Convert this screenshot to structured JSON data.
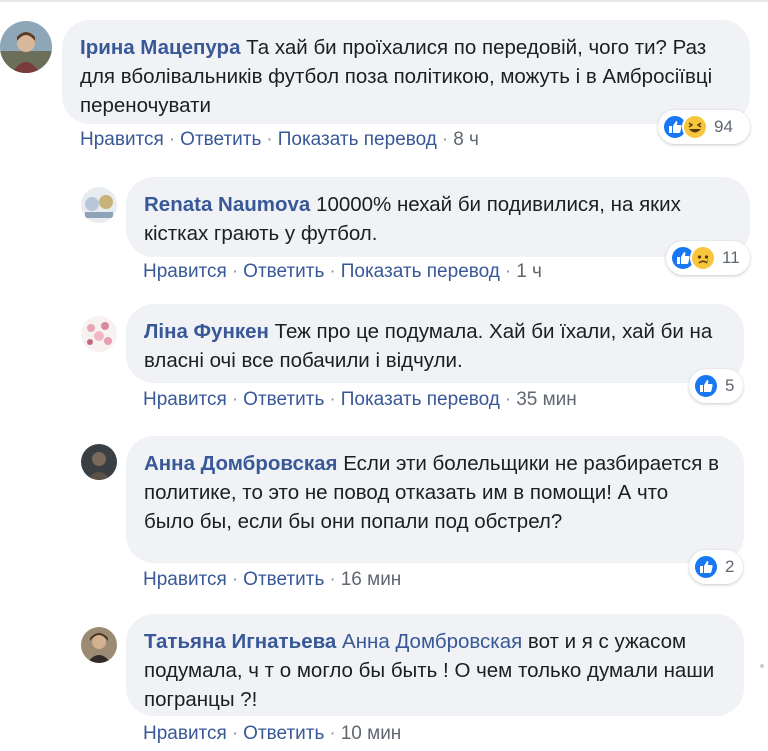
{
  "colors": {
    "bubble_bg": "#f0f2f5",
    "author": "#385898",
    "like_blue": "#1877f2",
    "emoji_yellow": "#f7c63d"
  },
  "actions": {
    "like": "Нравится",
    "reply": "Ответить",
    "translate": "Показать перевод",
    "separator": "·"
  },
  "comments": [
    {
      "author": "Ірина Мацепура",
      "text": "Та хай би проїхалися по передовій, чого ти? Раз для вболівальників футбол поза політикою, можуть і в Амбросіївці переночувати",
      "time": "8 ч",
      "reactions": {
        "icons": [
          "like-icon",
          "haha-icon"
        ],
        "count": "94"
      }
    },
    {
      "author": "Renata Naumova",
      "text": "10000% нехай би подивилися, на яких кістках грають у футбол.",
      "time": "1 ч",
      "reactions": {
        "icons": [
          "like-icon",
          "sad-icon"
        ],
        "count": "11"
      }
    },
    {
      "author": "Ліна Функен",
      "text": "Теж про це подумала. Хай би їхали, хай би на власні очі все побачили і відчули.",
      "time": "35 мин",
      "reactions": {
        "icons": [
          "like-icon"
        ],
        "count": "5"
      }
    },
    {
      "author": "Анна Домбровская",
      "text": "Если эти болельщики не разбирается в политике, то это не повод отказать им в помощи! А что было бы, если бы они попали под обстрел?",
      "time": "16 мин",
      "reactions": {
        "icons": [
          "like-icon"
        ],
        "count": "2"
      }
    },
    {
      "author": "Татьяна Игнатьева",
      "mention": "Анна Домбровская",
      "text": "вот и я с ужасом подумала, ч т о могло бы быть ! О чем только думали наши погранцы ?!",
      "time": "10 мин"
    }
  ]
}
